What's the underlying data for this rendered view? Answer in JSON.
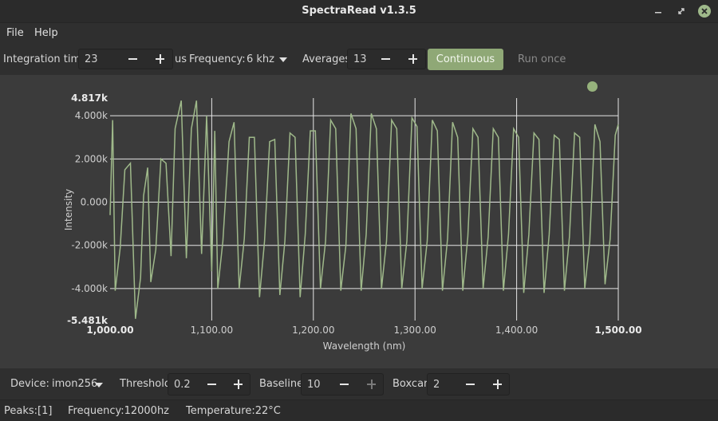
{
  "window": {
    "title": "SpectraRead v1.3.5"
  },
  "menu": {
    "items": [
      "File",
      "Help"
    ]
  },
  "toolbar": {
    "integration_label": "Integration time:",
    "integration_value": "23",
    "integration_unit": "us",
    "frequency_label": "Frequency:",
    "frequency_value": "6 khz",
    "averages_label": "Averages:",
    "averages_value": "13",
    "continuous_label": "Continuous",
    "run_once_label": "Run once"
  },
  "chart_data": {
    "type": "line",
    "xlabel": "Wavelength (nm)",
    "ylabel": "Intensity",
    "xlim": [
      1000,
      1500
    ],
    "ylim": [
      -5481,
      4817
    ],
    "x_ticks": [
      "1,000.00",
      "1,100.00",
      "1,200.00",
      "1,300.00",
      "1,400.00",
      "1,500.00"
    ],
    "y_ticks": [
      "4.817k",
      "4.000k",
      "2.000k",
      "0.000",
      "-2.000k",
      "-4.000k",
      "-5.481k"
    ],
    "grid": true,
    "series": [
      {
        "color": "#9fb98a",
        "x": [
          1000,
          1002.5,
          1005,
          1010,
          1014.5,
          1020,
          1025,
          1030,
          1033,
          1037,
          1040,
          1045,
          1050,
          1055,
          1060,
          1064,
          1070,
          1075,
          1080,
          1085,
          1090,
          1095,
          1100,
          1103,
          1106,
          1111,
          1117,
          1122,
          1127,
          1132,
          1137,
          1142,
          1147,
          1152,
          1157,
          1162,
          1167,
          1172,
          1177,
          1182,
          1187,
          1192,
          1197,
          1202,
          1207,
          1212,
          1217,
          1222,
          1227,
          1232,
          1237,
          1242,
          1247,
          1252,
          1257,
          1262,
          1267,
          1272,
          1277,
          1282,
          1287,
          1292,
          1297,
          1302,
          1307,
          1312,
          1317,
          1322,
          1327,
          1332,
          1337,
          1342,
          1347,
          1352,
          1357,
          1362,
          1367,
          1372,
          1377,
          1382,
          1387,
          1392,
          1397,
          1402,
          1407,
          1412,
          1417,
          1422,
          1427,
          1432,
          1437,
          1442,
          1447,
          1452,
          1457,
          1462,
          1467,
          1472,
          1477,
          1482,
          1487,
          1492,
          1497,
          1500
        ],
        "y": [
          -600,
          3800,
          -4100,
          -2100,
          1500,
          1800,
          -5400,
          -3500,
          300,
          1600,
          -3700,
          -2200,
          2000,
          1800,
          -2500,
          3400,
          4700,
          -2600,
          3400,
          4700,
          -2400,
          4000,
          -3200,
          3300,
          -4000,
          -1800,
          2800,
          3700,
          -4000,
          -1700,
          3000,
          3000,
          -4400,
          -1800,
          2800,
          2900,
          -4300,
          -1800,
          3200,
          3000,
          -4400,
          -1500,
          3300,
          3300,
          -4000,
          -1800,
          3800,
          3400,
          -4100,
          -2000,
          4100,
          3400,
          -4100,
          -1500,
          4100,
          3400,
          -4000,
          -1800,
          3800,
          3400,
          -4000,
          -1800,
          3900,
          3500,
          -4000,
          -1800,
          3800,
          3300,
          -4100,
          -1700,
          3700,
          3000,
          -4100,
          -1600,
          3400,
          3000,
          -4000,
          -1600,
          3400,
          3000,
          -4100,
          -1500,
          3400,
          3000,
          -4200,
          -1500,
          3200,
          2900,
          -4200,
          -1500,
          3100,
          2900,
          -4100,
          -1600,
          3200,
          3000,
          -4000,
          -1800,
          3600,
          2800,
          -3800,
          -1700,
          3100,
          3600
        ]
      }
    ]
  },
  "bottom": {
    "device_label": "Device:",
    "device_value": "imon256",
    "threshold_label": "Threshold:",
    "threshold_value": "0.2",
    "baseline_label": "Baseline:",
    "baseline_value": "10",
    "boxcar_label": "Boxcar:",
    "boxcar_value": "2"
  },
  "status": {
    "peaks": "Peaks:[1]",
    "frequency": "Frequency:12000hz",
    "temperature": "Temperature:22°C"
  },
  "colors": {
    "accent": "#8fa876",
    "plot_line": "#9fb98a",
    "plot_bg": "#3b3b3b",
    "window_bg": "#2f2f2f"
  }
}
